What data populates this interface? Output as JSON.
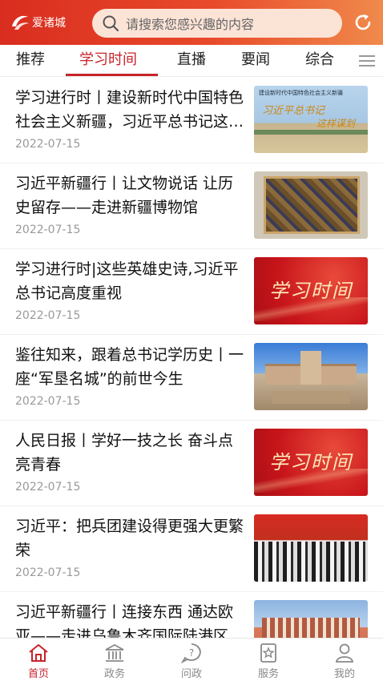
{
  "header": {
    "logo_text": "爱诸城",
    "search_placeholder": "请搜索您感兴趣的内容",
    "accent_color": "#d92d1f"
  },
  "tabs": [
    {
      "label": "推荐",
      "active": false
    },
    {
      "label": "学习时间",
      "active": true
    },
    {
      "label": "直播",
      "active": false
    },
    {
      "label": "要闻",
      "active": false
    },
    {
      "label": "综合",
      "active": false
    }
  ],
  "articles": [
    {
      "title": "学习进行时丨建设新时代中国特色社会主义新疆，习近平总书记这样谋划",
      "date": "2022-07-15",
      "thumb_icon": "landscape-image",
      "thumb_caption_small": "建设新时代中国特色社会主义新疆",
      "thumb_caption_1": "习近平总书记",
      "thumb_caption_2": "这样谋划"
    },
    {
      "title": "习近平新疆行丨让文物说话 让历史留存——走进新疆博物馆",
      "date": "2022-07-15",
      "thumb_icon": "artifact-textile-image"
    },
    {
      "title": "学习进行时|这些英雄史诗,习近平总书记高度重视",
      "date": "2022-07-15",
      "thumb_icon": "xuexi-shijian-banner",
      "thumb_text": "学习时间"
    },
    {
      "title": "鉴往知来，跟着总书记学历史丨一座“军垦名城”的前世今生",
      "date": "2022-07-15",
      "thumb_icon": "museum-building-image"
    },
    {
      "title": "人民日报丨学好一技之长 奋斗点亮青春",
      "date": "2022-07-15",
      "thumb_icon": "xuexi-shijian-banner",
      "thumb_text": "学习时间"
    },
    {
      "title": "习近平：把兵团建设得更强大更繁荣",
      "date": "2022-07-15",
      "thumb_icon": "people-gathering-image"
    },
    {
      "title": "习近平新疆行丨连接东西 通达欧亚——走进乌鲁木齐国际陆港区",
      "date": "",
      "thumb_icon": "building-image"
    }
  ],
  "bottom_nav": [
    {
      "label": "首页",
      "icon": "home-icon",
      "active": true
    },
    {
      "label": "政务",
      "icon": "government-icon",
      "active": false
    },
    {
      "label": "问政",
      "icon": "question-icon",
      "active": false
    },
    {
      "label": "服务",
      "icon": "service-icon",
      "active": false
    },
    {
      "label": "我的",
      "icon": "user-icon",
      "active": false
    }
  ]
}
